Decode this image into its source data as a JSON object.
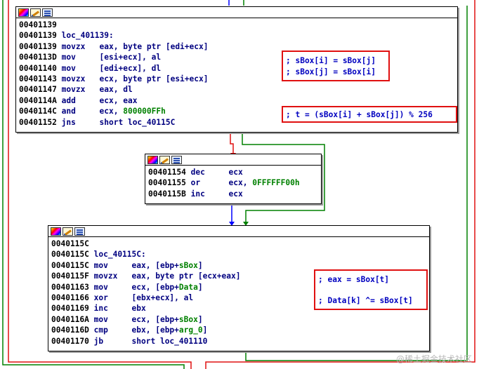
{
  "nodes": {
    "top": {
      "lines": [
        {
          "addr": "00401139",
          "text": ""
        },
        {
          "addr": "00401139",
          "text": "loc_401139:"
        },
        {
          "addr": "00401139",
          "mn": "movzx",
          "op": "eax, byte ptr [edi+ecx]"
        },
        {
          "addr": "0040113D",
          "mn": "mov",
          "op": "[esi+ecx], al"
        },
        {
          "addr": "00401140",
          "mn": "mov",
          "op": "[edi+ecx], dl"
        },
        {
          "addr": "00401143",
          "mn": "movzx",
          "op": "ecx, byte ptr [esi+ecx]"
        },
        {
          "addr": "00401147",
          "mn": "movzx",
          "op": "eax, dl"
        },
        {
          "addr": "0040114A",
          "mn": "add",
          "op": "ecx, eax"
        },
        {
          "addr": "0040114C",
          "mn": "and",
          "op": "ecx, ",
          "num": "800000FFh"
        },
        {
          "addr": "00401152",
          "mn": "jns",
          "op": "short loc_40115C"
        }
      ],
      "comments": [
        "; sBox[i] = sBox[j]",
        "; sBox[j] = sBox[i]",
        "; t = (sBox[i] + sBox[j]) % 256"
      ]
    },
    "middle": {
      "lines": [
        {
          "addr": "00401154",
          "mn": "dec",
          "op": "ecx"
        },
        {
          "addr": "00401155",
          "mn": "or",
          "op": "ecx, ",
          "num": "0FFFFFF00h"
        },
        {
          "addr": "0040115B",
          "mn": "inc",
          "op": "ecx"
        }
      ]
    },
    "bottom": {
      "lines": [
        {
          "addr": "0040115C",
          "text": ""
        },
        {
          "addr": "0040115C",
          "text": "loc_40115C:"
        },
        {
          "addr": "0040115C",
          "mn": "mov",
          "op": "eax, [ebp+",
          "var": "sBox",
          "tail": "]"
        },
        {
          "addr": "0040115F",
          "mn": "movzx",
          "op": "eax, byte ptr [ecx+eax]"
        },
        {
          "addr": "00401163",
          "mn": "mov",
          "op": "ecx, [ebp+",
          "var": "Data",
          "tail": "]"
        },
        {
          "addr": "00401166",
          "mn": "xor",
          "op": "[ebx+ecx], al"
        },
        {
          "addr": "00401169",
          "mn": "inc",
          "op": "ebx"
        },
        {
          "addr": "0040116A",
          "mn": "mov",
          "op": "ecx, [ebp+",
          "var": "sBox",
          "tail": "]"
        },
        {
          "addr": "0040116D",
          "mn": "cmp",
          "op": "ebx, [ebp+",
          "var": "arg_0",
          "tail": "]"
        },
        {
          "addr": "00401170",
          "mn": "jb",
          "op": "short loc_401110"
        }
      ],
      "comments": [
        "; eax = sBox[t]",
        "; Data[k] ^= sBox[t]"
      ]
    }
  },
  "watermark": "@稀土掘金技术社区",
  "colors": {
    "edge_true": "#008000",
    "edge_false": "#e01010",
    "edge_uncond": "#0000ff",
    "highlight": "#e01010"
  }
}
